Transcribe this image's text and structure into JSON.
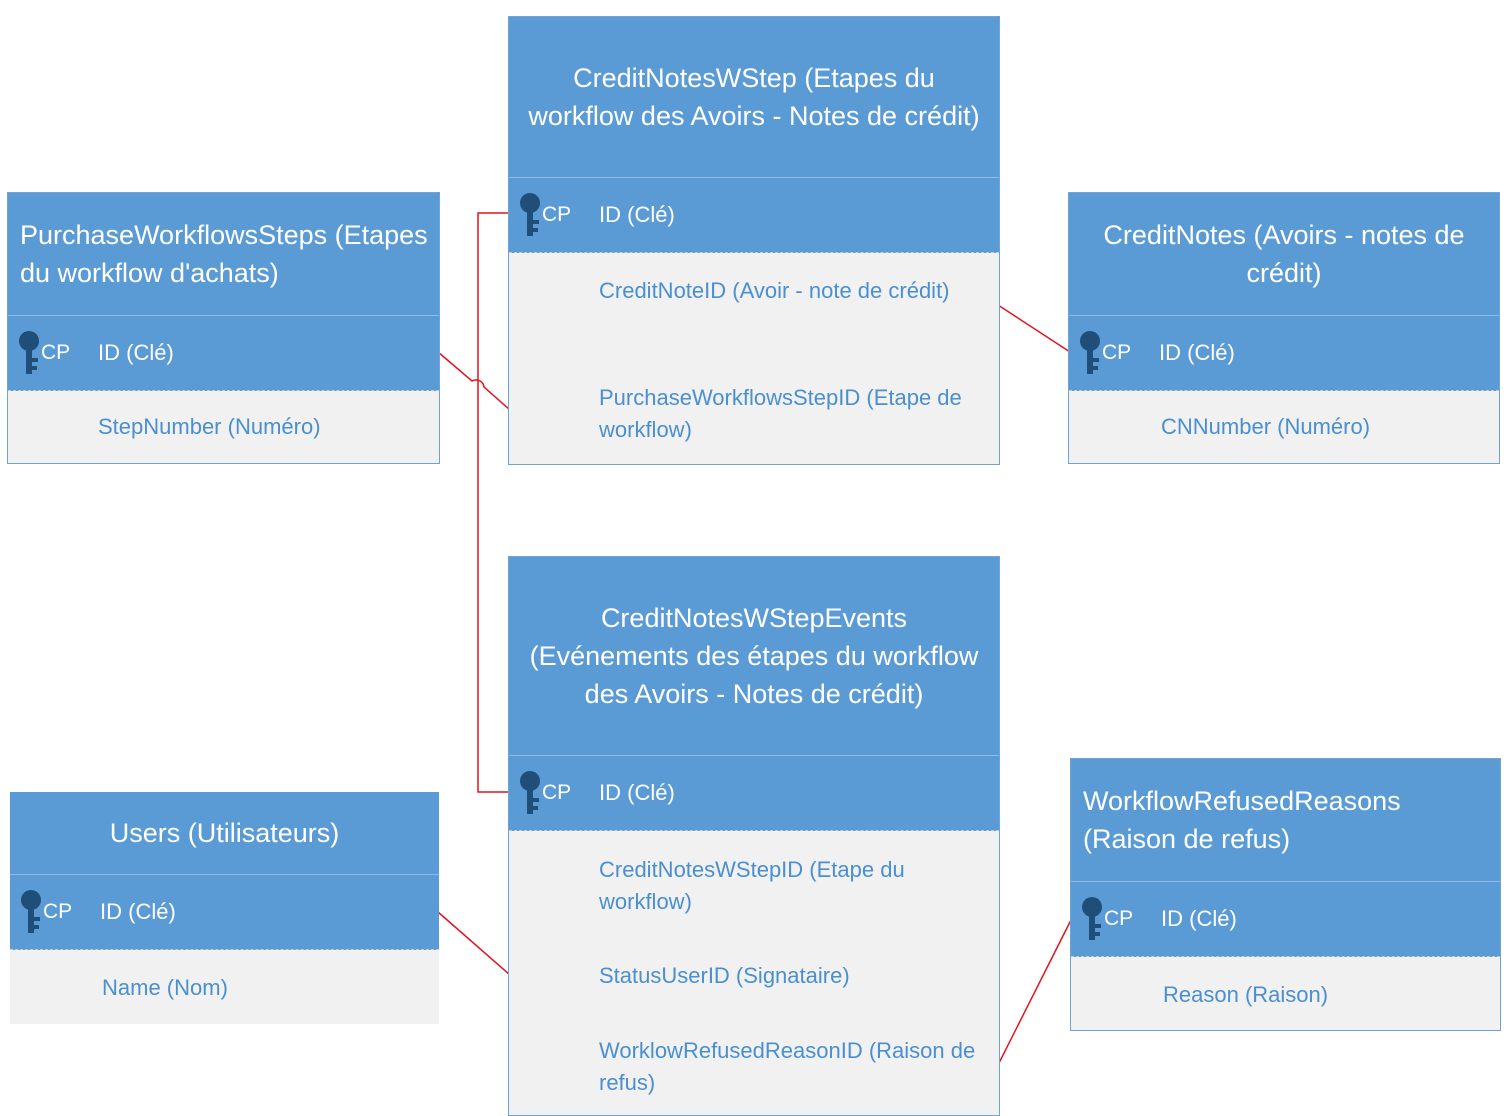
{
  "entities": {
    "purchase_steps": {
      "title": "PurchaseWorkflowsSteps (Etapes du workflow d'achats)",
      "pk_label": "CP",
      "pk_name": "ID (Clé)",
      "fields": [
        "StepNumber (Numéro)"
      ]
    },
    "credit_notes_wstep": {
      "title": "CreditNotesWStep (Etapes du workflow des Avoirs - Notes de crédit)",
      "pk_label": "CP",
      "pk_name": "ID (Clé)",
      "fields": [
        "CreditNoteID (Avoir - note de crédit)",
        "PurchaseWorkflowsStepID (Etape de workflow)"
      ]
    },
    "credit_notes": {
      "title": "CreditNotes (Avoirs - notes de crédit)",
      "pk_label": "CP",
      "pk_name": "ID (Clé)",
      "fields": [
        "CNNumber (Numéro)"
      ]
    },
    "credit_notes_wstep_events": {
      "title": "CreditNotesWStepEvents (Evénements des étapes du workflow des Avoirs - Notes de crédit)",
      "pk_label": "CP",
      "pk_name": "ID (Clé)",
      "fields": [
        "CreditNotesWStepID (Etape du workflow)",
        "StatusUserID (Signataire)",
        "WorklowRefusedReasonID (Raison de refus)"
      ]
    },
    "users": {
      "title": "Users (Utilisateurs)",
      "pk_label": "CP",
      "pk_name": "ID (Clé)",
      "fields": [
        "Name (Nom)"
      ]
    },
    "workflow_refused_reasons": {
      "title": "WorkflowRefusedReasons (Raison de refus)",
      "pk_label": "CP",
      "pk_name": "ID (Clé)",
      "fields": [
        "Reason (Raison)"
      ]
    }
  },
  "colors": {
    "header": "#5b9bd5",
    "body": "#f1f1f1",
    "field_text": "#4a8fd0",
    "key_icon": "#1f4e79",
    "connector": "#e0141e"
  },
  "icons": {
    "primary_key": "key-icon"
  }
}
